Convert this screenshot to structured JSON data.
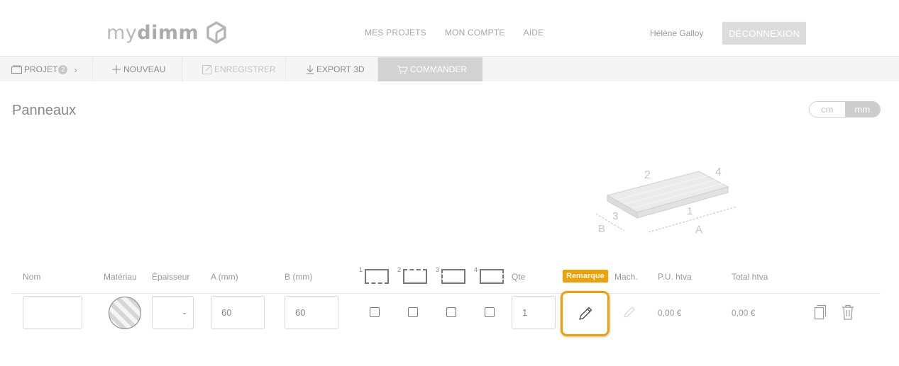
{
  "header": {
    "logo_light": "my",
    "logo_bold": "dimm",
    "nav": [
      "MES PROJETS",
      "MON COMPTE",
      "AIDE"
    ],
    "user_name": "Hélène Galloy",
    "logout_label": "DÉCONNEXION"
  },
  "toolbar": {
    "projet_label": "PROJET",
    "projet_count": "2",
    "nouveau_label": "NOUVEAU",
    "enregistrer_label": "ENREGISTRER",
    "export_label": "EXPORT 3D",
    "commander_label": "COMMANDER"
  },
  "page": {
    "title": "Panneaux",
    "unit_cm": "cm",
    "unit_mm": "mm",
    "selected_unit": "mm"
  },
  "diagram": {
    "labels": [
      "2",
      "4",
      "3",
      "1",
      "B",
      "A"
    ]
  },
  "table": {
    "headers": {
      "nom": "Nom",
      "materiau": "Matériau",
      "epaisseur": "Épaisseur",
      "a": "A (mm)",
      "b": "B (mm)",
      "edges": [
        "1",
        "2",
        "3",
        "4"
      ],
      "qte": "Qte",
      "remarque": "Remarque",
      "mach": "Mach.",
      "pu": "P.U. htva",
      "total": "Total htva"
    },
    "row": {
      "nom": "",
      "epaisseur": "-",
      "a": "60",
      "b": "60",
      "qte": "1",
      "pu": "0,00 €",
      "total": "0,00 €"
    }
  },
  "colors": {
    "accent": "#f2a000",
    "muted": "#999999"
  },
  "icons": [
    "logo-cube-icon",
    "folder-icon",
    "chevron-right-icon",
    "plus-icon",
    "edit-icon",
    "download-icon",
    "cart-icon",
    "pencil-icon",
    "duplicate-icon",
    "trash-icon"
  ]
}
